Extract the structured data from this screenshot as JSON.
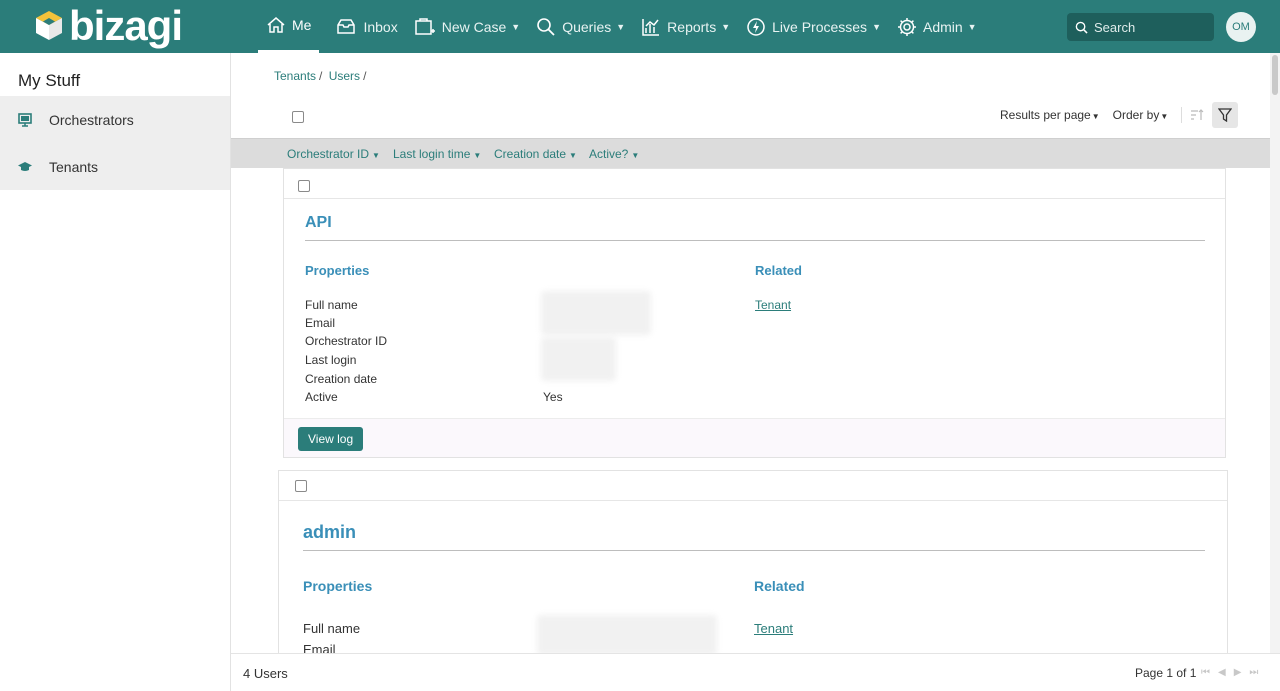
{
  "colors": {
    "brand": "#2b7d7a",
    "accent_text": "#3a8fb8",
    "sidebar_bg": "#eeeeee",
    "filterbar_bg": "#dcdcdc"
  },
  "header": {
    "logo_text": "bizagi",
    "nav": [
      {
        "label": "Me",
        "icon": "home-icon",
        "active": true
      },
      {
        "label": "Inbox",
        "icon": "inbox-icon"
      },
      {
        "label": "New Case",
        "icon": "new-case-icon",
        "dropdown": true
      },
      {
        "label": "Queries",
        "icon": "search-icon",
        "dropdown": true
      },
      {
        "label": "Reports",
        "icon": "reports-icon",
        "dropdown": true
      },
      {
        "label": "Live Processes",
        "icon": "live-processes-icon",
        "dropdown": true
      },
      {
        "label": "Admin",
        "icon": "gear-icon",
        "dropdown": true
      }
    ],
    "search_placeholder": "Search",
    "avatar_initials": "OM"
  },
  "sidebar": {
    "title": "My Stuff",
    "items": [
      {
        "label": "Orchestrators",
        "icon": "monitor-icon"
      },
      {
        "label": "Tenants",
        "icon": "graduation-cap-icon"
      }
    ]
  },
  "breadcrumb": [
    "Tenants",
    "Users"
  ],
  "toolbar": {
    "results_per_page": "Results per page",
    "order_by": "Order by"
  },
  "filters": [
    "Orchestrator ID",
    "Last login time",
    "Creation date",
    "Active?"
  ],
  "cards": [
    {
      "title": "API",
      "properties_heading": "Properties",
      "related_heading": "Related",
      "properties": [
        "Full name",
        "Email",
        "Orchestrator ID",
        "Last login",
        "Creation date",
        "Active"
      ],
      "active_value": "Yes",
      "related_link": "Tenant",
      "button": "View log"
    },
    {
      "title": "admin",
      "properties_heading": "Properties",
      "related_heading": "Related",
      "properties": [
        "Full name",
        "Email"
      ],
      "related_link": "Tenant"
    }
  ],
  "footer": {
    "count": "4 Users",
    "page": "Page 1 of 1"
  }
}
